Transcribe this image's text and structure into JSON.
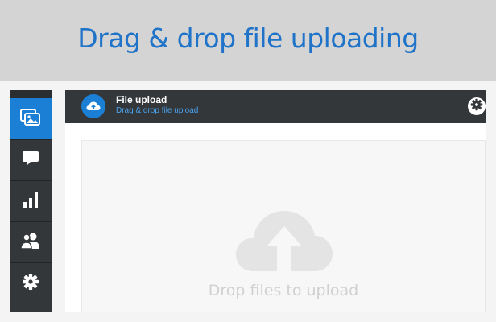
{
  "banner": {
    "title": "Drag & drop file uploading"
  },
  "sidebar": {
    "items": [
      {
        "icon": "image-gallery-icon",
        "active": true
      },
      {
        "icon": "chat-bubble-icon",
        "active": false
      },
      {
        "icon": "bar-chart-icon",
        "active": false
      },
      {
        "icon": "users-icon",
        "active": false
      },
      {
        "icon": "gear-icon",
        "active": false
      }
    ]
  },
  "panel": {
    "title": "File upload",
    "subtitle": "Drag & drop file upload",
    "header_icon": "cloud-upload-icon",
    "settings_icon": "gear-icon"
  },
  "dropzone": {
    "icon": "cloud-upload-icon",
    "label": "Drop files to upload"
  },
  "colors": {
    "accent": "#1b7fd6",
    "banner_text": "#1f73c8",
    "sidebar_bg": "#34373a",
    "subtitle": "#4aa3f0"
  }
}
